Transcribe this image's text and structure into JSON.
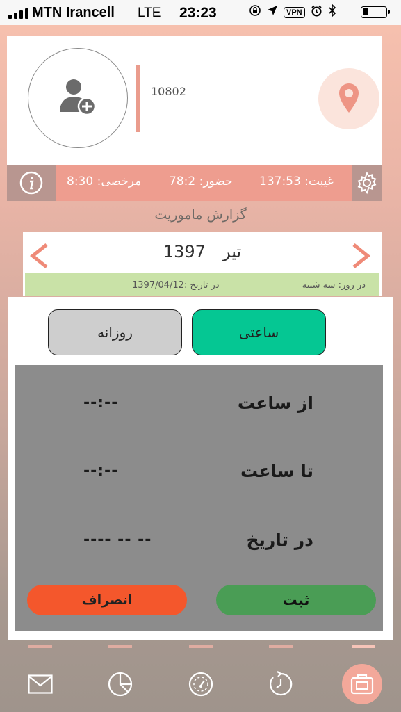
{
  "status_bar": {
    "carrier": "MTN Irancell",
    "network": "LTE",
    "time": "23:23",
    "vpn": "VPN"
  },
  "profile": {
    "user_id": "10802",
    "user_name": "—"
  },
  "stats": {
    "absence": "غیبت: 137:53",
    "presence": "حضور: 78:2",
    "leave": "مرخصی: 8:30"
  },
  "page_title": "گزارش ماموریت",
  "calendar": {
    "year": "1397",
    "month": "تیر",
    "day_label": "در روز: سه شنبه",
    "date_label": "در تاریخ :1397/04/12"
  },
  "modal": {
    "tab_daily": "روزانه",
    "tab_hourly": "ساعتی",
    "from_time_label": "از ساعت",
    "from_time_value": "--:--",
    "to_time_label": "تا ساعت",
    "to_time_value": "--:--",
    "date_label": "در تاریخ",
    "date_value": "---- -- --",
    "submit": "ثبت",
    "cancel": "انصراف"
  },
  "colors": {
    "accent": "#ee9d8f",
    "hourly_active": "#05c793",
    "submit": "#4a9d55",
    "cancel": "#f4572c",
    "day_strip": "#c9e2a7"
  },
  "nav": {
    "items": [
      "mail-icon",
      "pie-chart-icon",
      "gauge-icon",
      "history-icon",
      "briefcase-icon"
    ],
    "active": "briefcase-icon"
  }
}
